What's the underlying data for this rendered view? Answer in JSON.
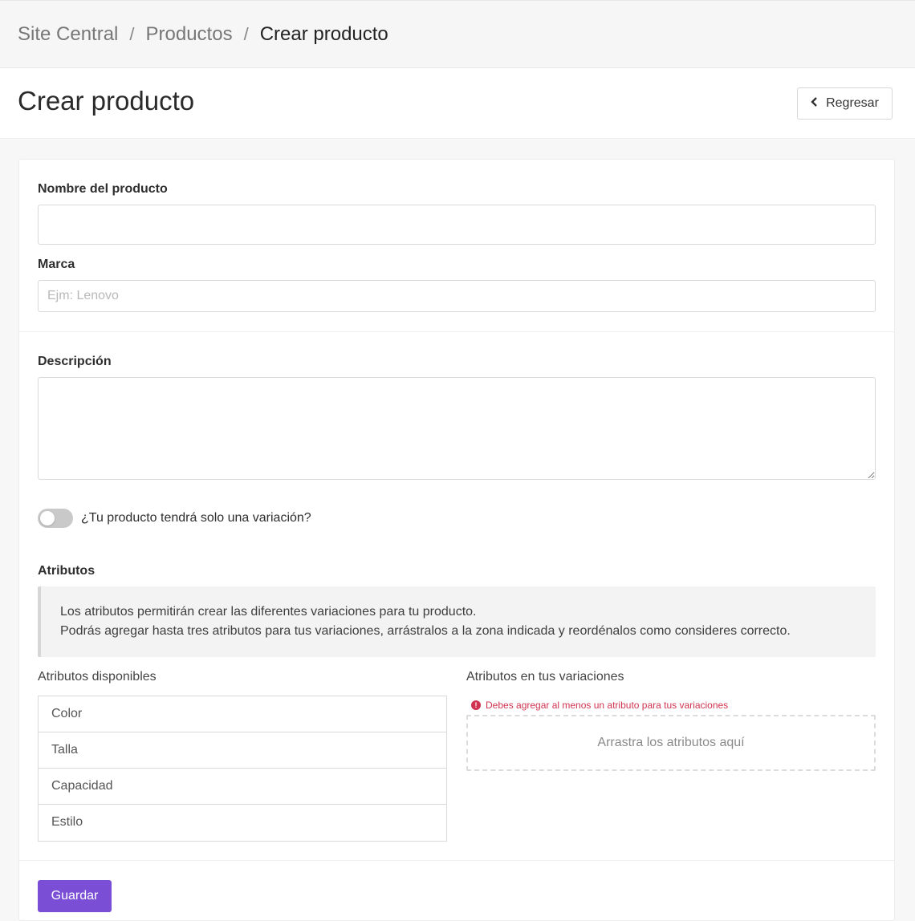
{
  "breadcrumb": {
    "items": [
      "Site Central",
      "Productos",
      "Crear producto"
    ],
    "separator": "/"
  },
  "header": {
    "title": "Crear producto",
    "back_label": "Regresar"
  },
  "form": {
    "name_label": "Nombre del producto",
    "name_value": "",
    "brand_label": "Marca",
    "brand_value": "",
    "brand_placeholder": "Ejm: Lenovo",
    "description_label": "Descripción",
    "description_value": "",
    "single_variation_label": "¿Tu producto tendrá solo una variación?",
    "single_variation_enabled": false
  },
  "attributes": {
    "title": "Atributos",
    "info_line1": "Los atributos permitirán crear las diferentes variaciones para tu producto.",
    "info_line2": "Podrás agregar hasta tres atributos para tus variaciones, arrástralos a la zona indicada y reordénalos como consideres correcto.",
    "available_label": "Atributos disponibles",
    "available": [
      "Color",
      "Talla",
      "Capacidad",
      "Estilo"
    ],
    "selected_label": "Atributos en tus variaciones",
    "error_message": "Debes agregar al menos un atributo para tus variaciones",
    "dropzone_text": "Arrastra los atributos aquí"
  },
  "actions": {
    "save_label": "Guardar"
  },
  "colors": {
    "primary": "#7a4fd6",
    "error": "#d0334f"
  }
}
